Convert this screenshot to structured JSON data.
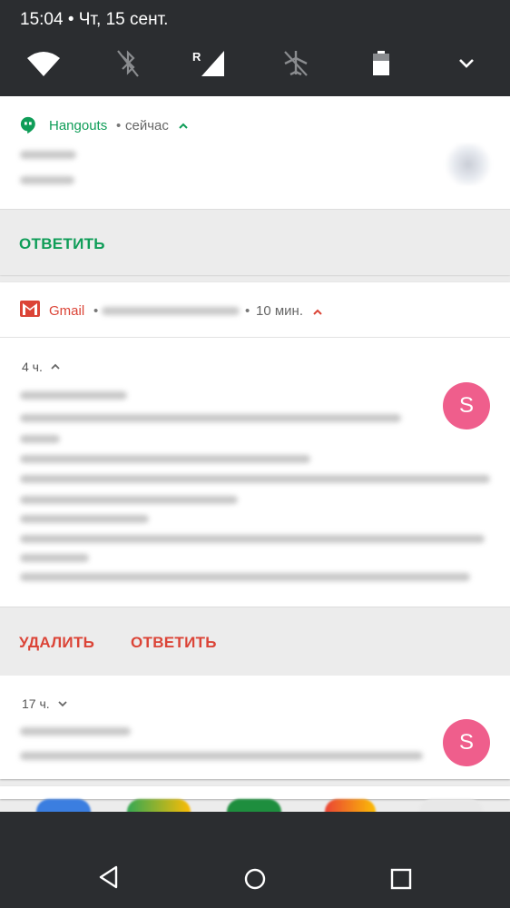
{
  "status": {
    "time": "15:04",
    "date_separator": " • ",
    "date": "Чт, 15 сент.",
    "roaming_indicator": "R",
    "icons": [
      "wifi-icon",
      "bluetooth-off-icon",
      "signal-roaming-icon",
      "airplane-mode-icon",
      "battery-icon",
      "expand-chevron-icon"
    ]
  },
  "hangouts": {
    "app_name": "Hangouts",
    "separator": "•",
    "time": "сейчас",
    "reply_label": "ОТВЕТИТЬ",
    "accent_color": "#0f9d58"
  },
  "gmail": {
    "app_name": "Gmail",
    "separator": "•",
    "time": "10 мин.",
    "accent_color": "#db4437",
    "messages": [
      {
        "age": "4 ч.",
        "avatar_letter": "S",
        "delete_label": "УДАЛИТЬ",
        "reply_label": "ОТВЕТИТЬ"
      },
      {
        "age": "17 ч.",
        "avatar_letter": "S"
      }
    ]
  },
  "avatar_color": "#ef5e8c",
  "navigation": {
    "icons": [
      "back-icon",
      "home-icon",
      "recents-icon"
    ]
  }
}
